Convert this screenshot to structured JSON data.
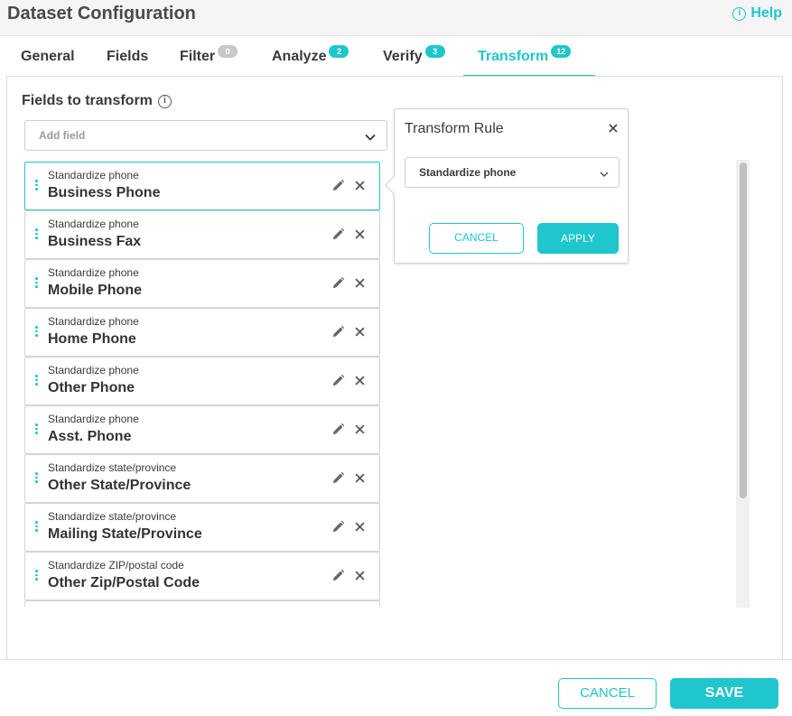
{
  "header": {
    "title": "Dataset Configuration",
    "help_icon": "info-circle-icon",
    "help_label": "Help"
  },
  "tabs": [
    {
      "label": "General",
      "badge": null
    },
    {
      "label": "Fields",
      "badge": null
    },
    {
      "label": "Filter",
      "badge": "0"
    },
    {
      "label": "Analyze",
      "badge": "2"
    },
    {
      "label": "Verify",
      "badge": "3"
    },
    {
      "label": "Transform",
      "badge": "12",
      "active": true
    }
  ],
  "section": {
    "title": "Fields to transform",
    "info_icon": "info-circle-icon"
  },
  "add_field": {
    "placeholder": "Add field",
    "value": ""
  },
  "fields": [
    {
      "rule": "Standardize phone",
      "name": "Business Phone"
    },
    {
      "rule": "Standardize phone",
      "name": "Business Fax"
    },
    {
      "rule": "Standardize phone",
      "name": "Mobile Phone"
    },
    {
      "rule": "Standardize phone",
      "name": "Home Phone"
    },
    {
      "rule": "Standardize phone",
      "name": "Other Phone"
    },
    {
      "rule": "Standardize phone",
      "name": "Asst. Phone"
    },
    {
      "rule": "Standardize state/province",
      "name": "Other State/Province"
    },
    {
      "rule": "Standardize state/province",
      "name": "Mailing State/Province"
    },
    {
      "rule": "Standardize ZIP/postal code",
      "name": "Other Zip/Postal Code"
    }
  ],
  "popover": {
    "title": "Transform Rule",
    "selected_rule": "Standardize phone",
    "cancel_label": "CANCEL",
    "apply_label": "APPLY"
  },
  "footer": {
    "cancel_label": "CANCEL",
    "save_label": "SAVE"
  },
  "colors": {
    "accent": "#1fc6cc",
    "badge_inactive": "#c8c8c8",
    "text": "#3a3a3a"
  }
}
